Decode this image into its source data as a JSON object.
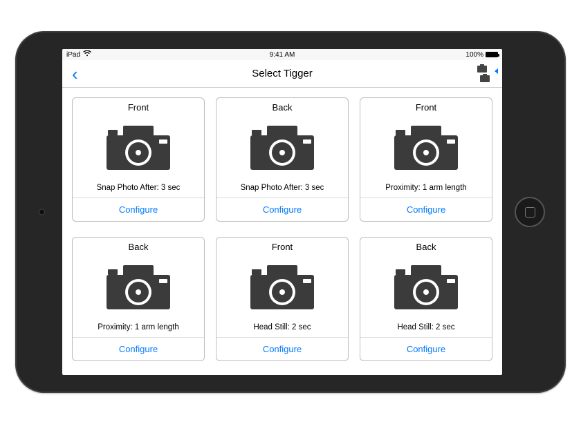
{
  "status": {
    "carrier": "iPad",
    "time": "9:41 AM",
    "battery_pct": "100%"
  },
  "nav": {
    "title": "Select Tigger"
  },
  "cards": [
    {
      "title": "Front",
      "desc": "Snap Photo After: 3 sec",
      "action": "Configure"
    },
    {
      "title": "Back",
      "desc": "Snap Photo After: 3 sec",
      "action": "Configure"
    },
    {
      "title": "Front",
      "desc": "Proximity: 1 arm length",
      "action": "Configure"
    },
    {
      "title": "Back",
      "desc": "Proximity: 1 arm length",
      "action": "Configure"
    },
    {
      "title": "Front",
      "desc": "Head Still: 2 sec",
      "action": "Configure"
    },
    {
      "title": "Back",
      "desc": "Head Still: 2 sec",
      "action": "Configure"
    }
  ]
}
